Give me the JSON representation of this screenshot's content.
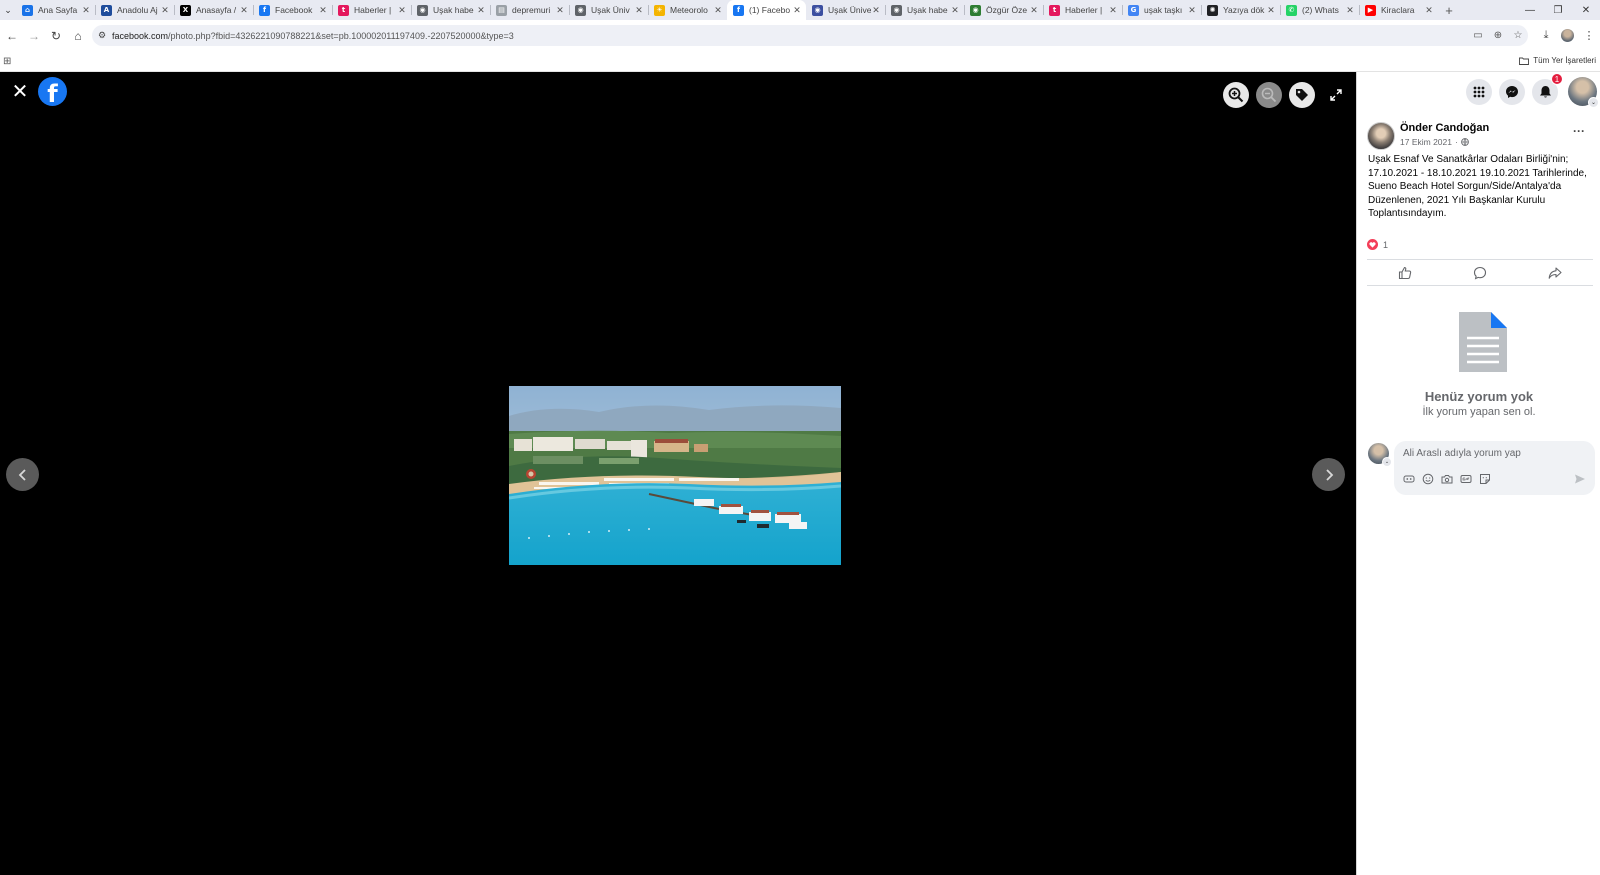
{
  "browser": {
    "tabs": [
      {
        "title": "Ana Sayfa",
        "favicon_color": "#1a73e8",
        "favicon_icon": "home-icon",
        "active": false
      },
      {
        "title": "Anadolu Aj",
        "favicon_color": "#1f4d9c",
        "favicon_icon": "aa-icon",
        "active": false
      },
      {
        "title": "Anasayfa /",
        "favicon_color": "#000000",
        "favicon_icon": "x-icon",
        "active": false
      },
      {
        "title": "Facebook",
        "favicon_color": "#1877f2",
        "favicon_icon": "facebook-icon",
        "active": false
      },
      {
        "title": "Haberler |",
        "favicon_color": "#e4185d",
        "favicon_icon": "te-icon",
        "active": false
      },
      {
        "title": "Uşak habe",
        "favicon_color": "#5f6368",
        "favicon_icon": "globe-icon",
        "active": false
      },
      {
        "title": "depremuri",
        "favicon_color": "#9aa0a6",
        "favicon_icon": "page-icon",
        "active": false
      },
      {
        "title": "Uşak Üniv",
        "favicon_color": "#5f6368",
        "favicon_icon": "globe-icon",
        "active": false
      },
      {
        "title": "Meteorolo",
        "favicon_color": "#f4b400",
        "favicon_icon": "weather-icon",
        "active": false
      },
      {
        "title": "(1) Facebo",
        "favicon_color": "#1877f2",
        "favicon_icon": "facebook-icon",
        "active": true
      },
      {
        "title": "Uşak Ünive",
        "favicon_color": "#3c4fa0",
        "favicon_icon": "globe-icon",
        "active": false
      },
      {
        "title": "Uşak habe",
        "favicon_color": "#5f6368",
        "favicon_icon": "globe-icon",
        "active": false
      },
      {
        "title": "Özgür Öze",
        "favicon_color": "#2e7d32",
        "favicon_icon": "globe-icon",
        "active": false
      },
      {
        "title": "Haberler |",
        "favicon_color": "#e4185d",
        "favicon_icon": "te-icon",
        "active": false
      },
      {
        "title": "uşak taşkı",
        "favicon_color": "#4285f4",
        "favicon_icon": "google-icon",
        "active": false
      },
      {
        "title": "Yazıya dök",
        "favicon_color": "#202124",
        "favicon_icon": "openai-icon",
        "active": false
      },
      {
        "title": "(2) Whats",
        "favicon_color": "#25d366",
        "favicon_icon": "whatsapp-icon",
        "active": false
      },
      {
        "title": "Kiraclara",
        "favicon_color": "#ff0000",
        "favicon_icon": "youtube-icon",
        "active": false
      }
    ],
    "url_main": "facebook.com",
    "url_rest": "/photo.php?fbid=4326221090788221&set=pb.100002011197409.-2207520000&type=3",
    "all_bookmarks_label": "Tüm Yer İşaretleri"
  },
  "header": {
    "notification_count": "1"
  },
  "post": {
    "author": "Önder Candoğan",
    "date": "17 Ekim 2021",
    "text": "Uşak Esnaf Ve Sanatkârlar Odaları Birliği'nin; 17.10.2021 - 18.10.2021 19.10.2021 Tarihlerinde, Sueno Beach Hotel Sorgun/Side/Antalya'da Düzenlenen, 2021 Yılı Başkanlar Kurulu Toplantısındayım.",
    "reaction_count": "1"
  },
  "comments": {
    "empty_title": "Henüz yorum yok",
    "empty_subtitle": "İlk yorum yapan sen ol.",
    "placeholder": "Ali Araslı adıyla yorum yap"
  },
  "colors": {
    "facebook_blue": "#1877f2",
    "viewer_background": "#000000",
    "love_red": "#f33e58",
    "badge_red": "#e41e3f"
  }
}
